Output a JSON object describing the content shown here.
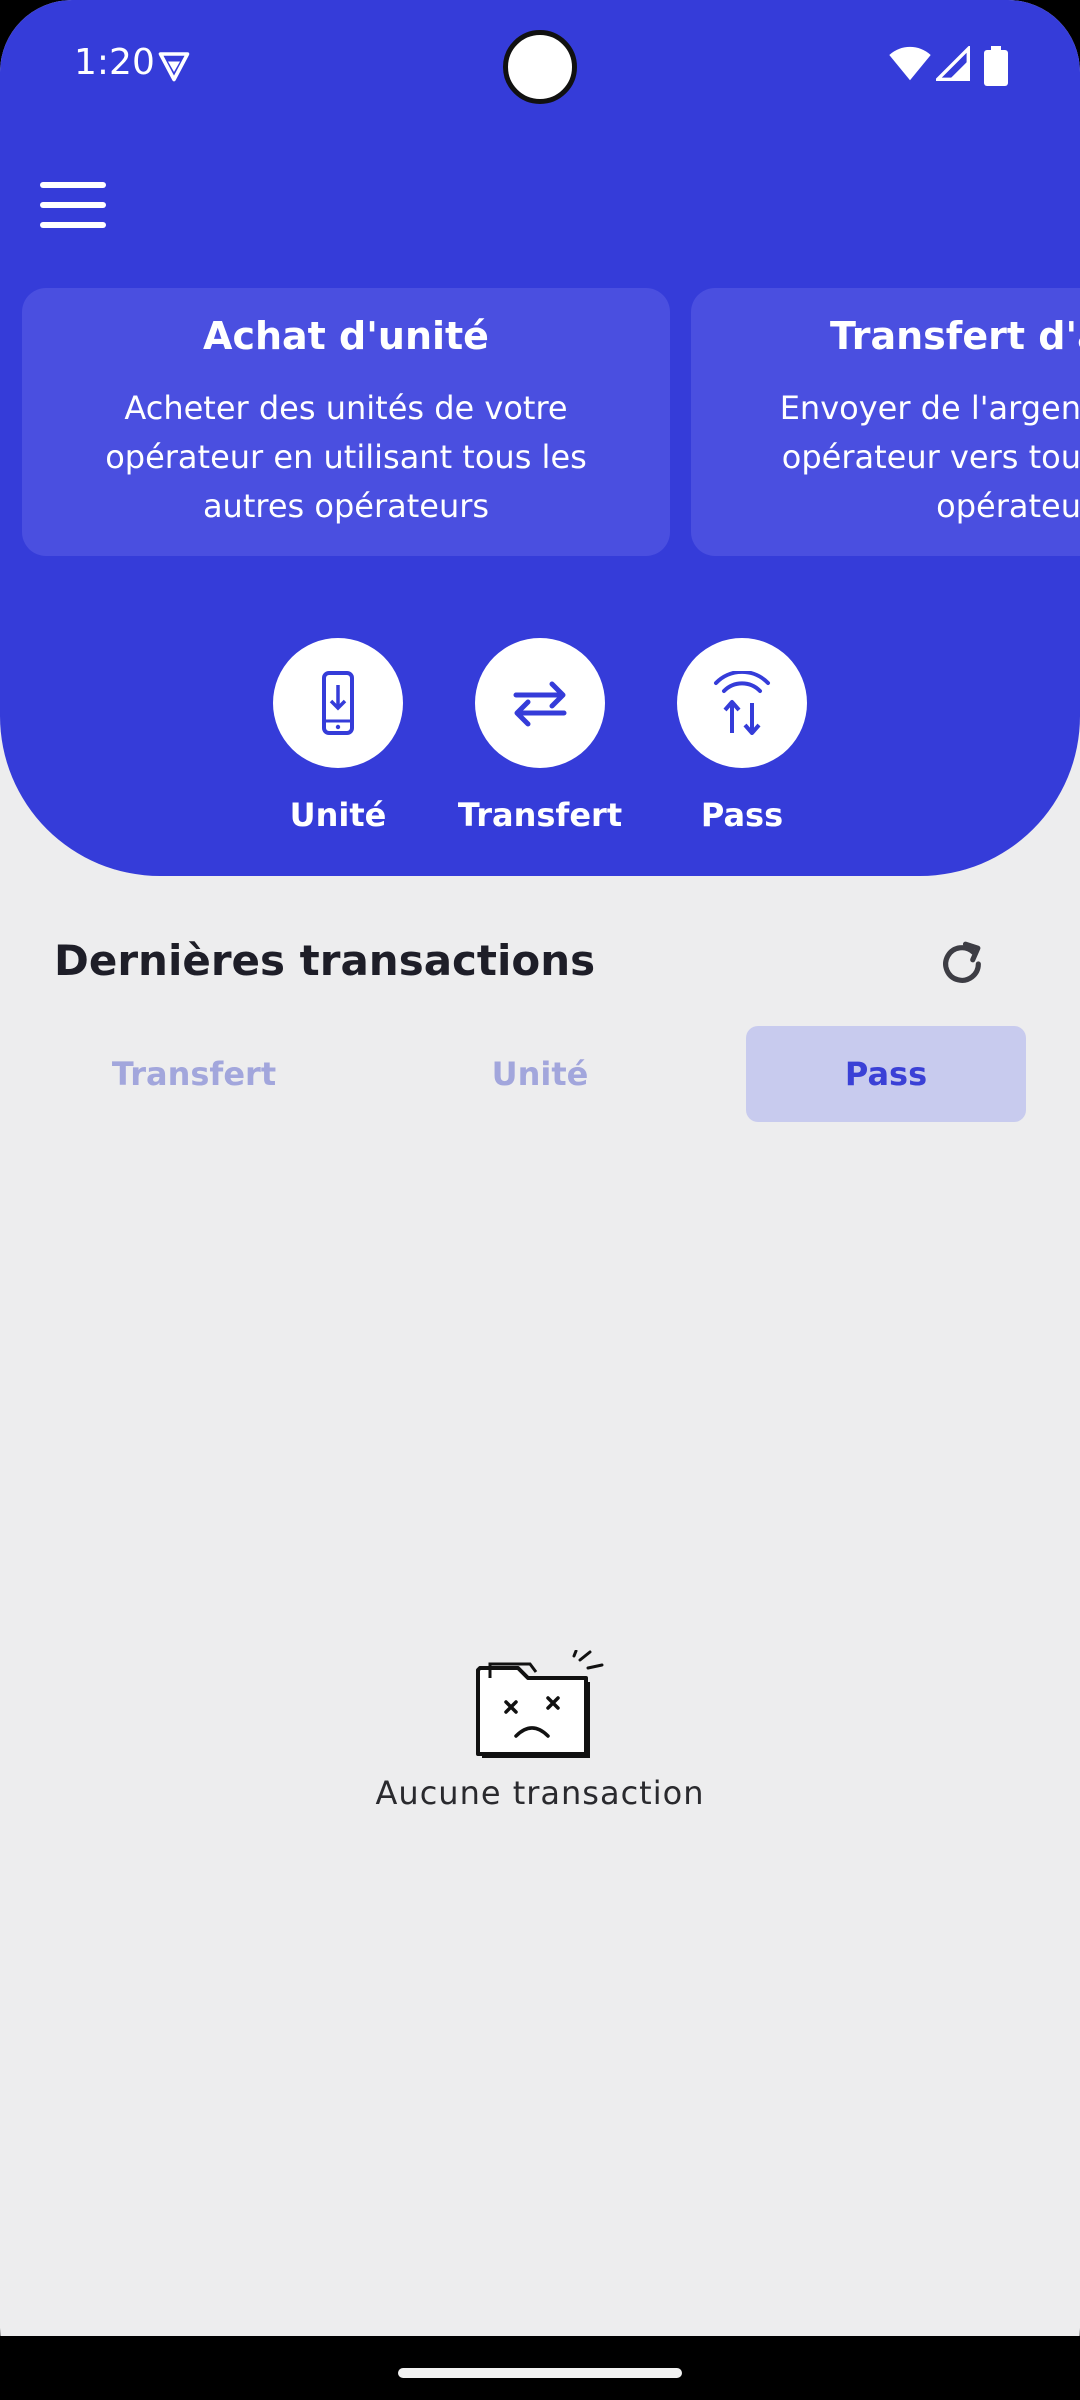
{
  "status_bar": {
    "time": "1:20"
  },
  "cards": [
    {
      "title": "Achat d'unité",
      "desc": "Acheter des unités de votre opérateur en utilisant tous les autres opérateurs"
    },
    {
      "title": "Transfert d'a",
      "desc": "Envoyer de l'argen opérateur vers tou opérateu"
    }
  ],
  "actions": [
    {
      "label": "Unité",
      "icon": "phone-download-icon"
    },
    {
      "label": "Transfert",
      "icon": "swap-arrows-icon"
    },
    {
      "label": "Pass",
      "icon": "data-transfer-icon"
    }
  ],
  "transactions": {
    "title": "Dernières transactions",
    "tabs": [
      "Transfert",
      "Unité",
      "Pass"
    ],
    "active_tab": "Pass",
    "empty_message": "Aucune transaction"
  },
  "colors": {
    "primary": "#353cd9",
    "card": "#4a4fe0",
    "background": "#ededee",
    "active_tab_bg": "#c8cbee",
    "inactive_tab_text": "#a2a6dc"
  }
}
